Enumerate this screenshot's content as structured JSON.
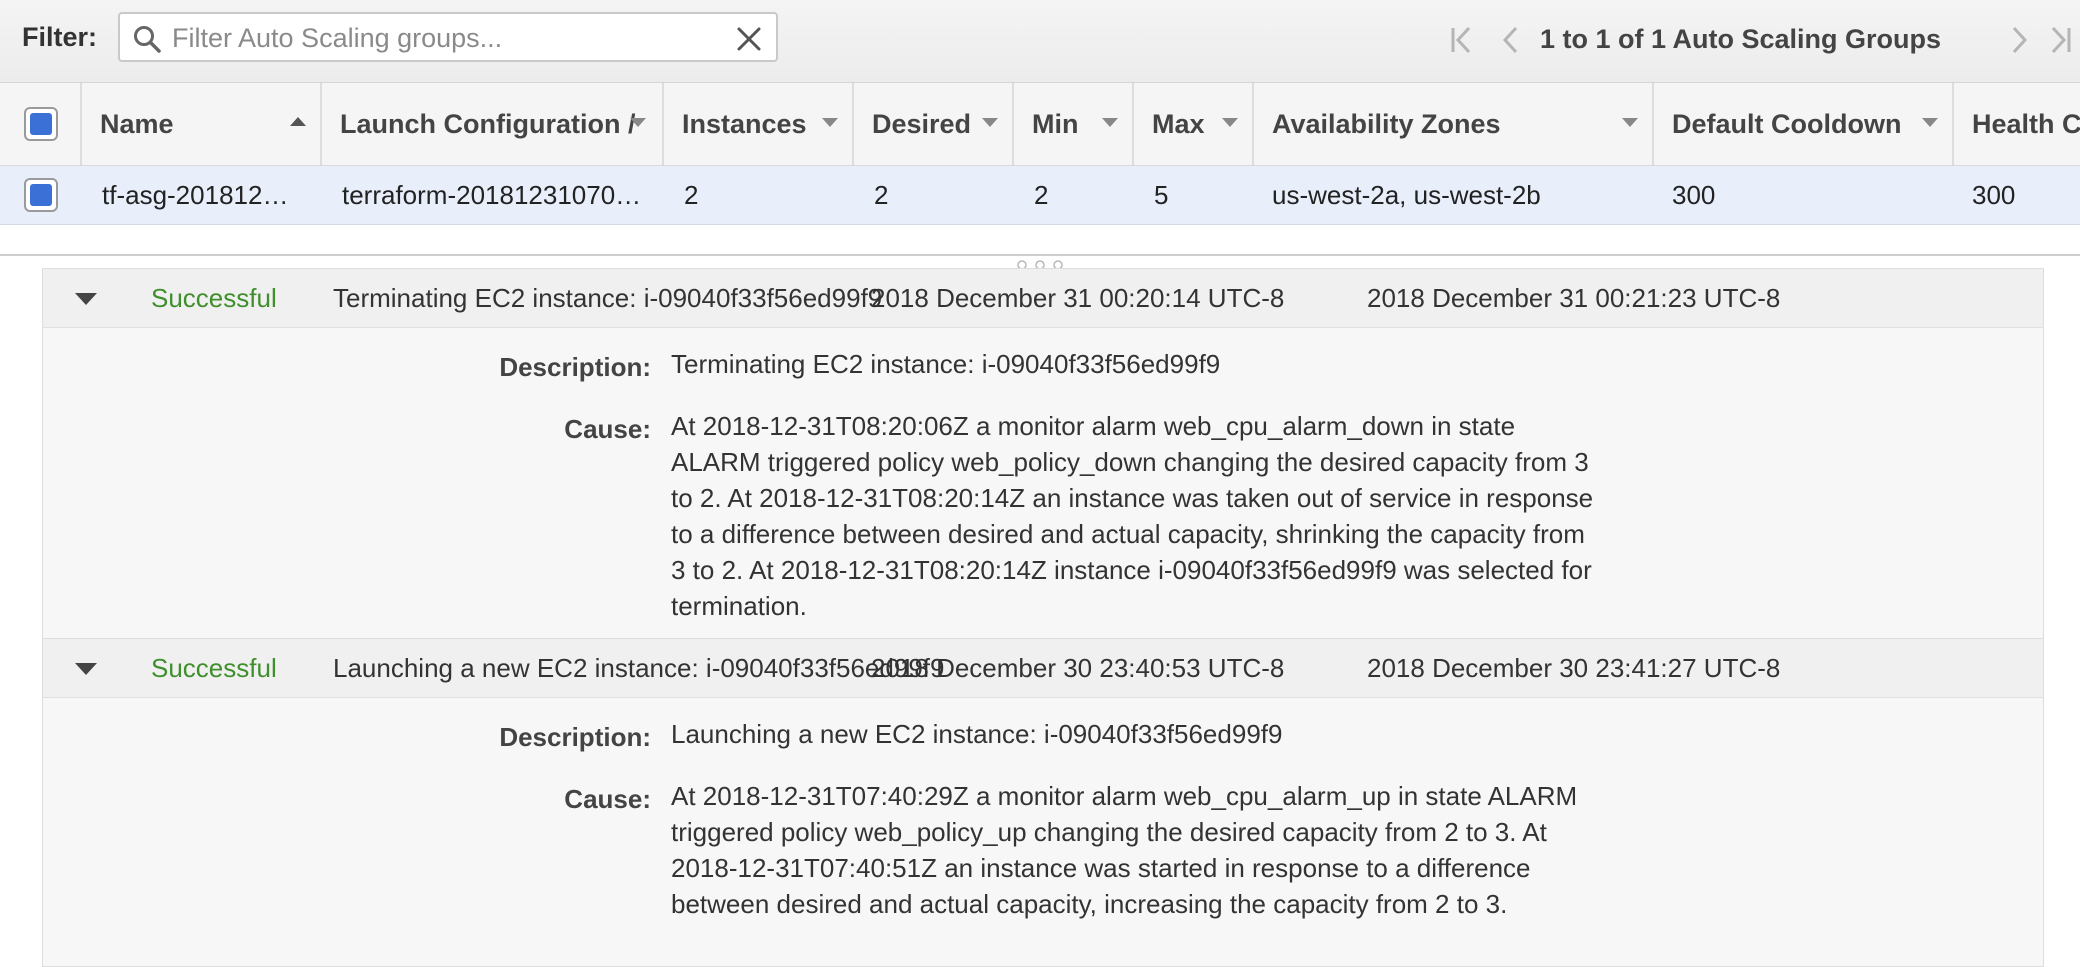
{
  "toolbar": {
    "filter_label": "Filter:",
    "search_placeholder": "Filter Auto Scaling groups...",
    "pagination_text": "1 to 1 of 1 Auto Scaling Groups"
  },
  "table": {
    "columns": [
      "Name",
      "Launch Configuration / ",
      "Instances",
      "Desired",
      "Min",
      "Max",
      "Availability Zones",
      "Default Cooldown",
      "Health C"
    ],
    "rows": [
      {
        "name": "tf-asg-201812…",
        "launch_configuration": "terraform-20181231070…",
        "instances": "2",
        "desired": "2",
        "min": "2",
        "max": "5",
        "availability_zones": "us-west-2a, us-west-2b",
        "default_cooldown": "300",
        "health_check": "300"
      }
    ]
  },
  "activities": [
    {
      "status": "Successful",
      "description": "Terminating EC2 instance: i-09040f33f56ed99f9",
      "start_time": "2018 December 31 00:20:14 UTC-8",
      "end_time": "2018 December 31 00:21:23 UTC-8",
      "description_label": "Description:",
      "description_value": "Terminating EC2 instance: i-09040f33f56ed99f9",
      "cause_label": "Cause:",
      "cause_value": "At 2018-12-31T08:20:06Z a monitor alarm web_cpu_alarm_down in state ALARM triggered policy web_policy_down changing the desired capacity from 3 to 2. At 2018-12-31T08:20:14Z an instance was taken out of service in response to a difference between desired and actual capacity, shrinking the capacity from 3 to 2. At 2018-12-31T08:20:14Z instance i-09040f33f56ed99f9 was selected for termination."
    },
    {
      "status": "Successful",
      "description": "Launching a new EC2 instance: i-09040f33f56ed99f9",
      "start_time": "2018 December 30 23:40:53 UTC-8",
      "end_time": "2018 December 30 23:41:27 UTC-8",
      "description_label": "Description:",
      "description_value": "Launching a new EC2 instance: i-09040f33f56ed99f9",
      "cause_label": "Cause:",
      "cause_value": "At 2018-12-31T07:40:29Z a monitor alarm web_cpu_alarm_up in state ALARM triggered policy web_policy_up changing the desired capacity from 2 to 3. At 2018-12-31T07:40:51Z an instance was started in response to a difference between desired and actual capacity, increasing the capacity from 2 to 3."
    }
  ],
  "colors": {
    "accent": "#3b71d6",
    "success": "#3f8f2d",
    "selected_row": "#e8effb"
  },
  "icons": {
    "search": "search-icon",
    "clear": "close-icon",
    "first_page": "first-page-icon",
    "prev_page": "prev-page-icon",
    "next_page": "next-page-icon",
    "last_page": "last-page-icon",
    "expand": "triangle-down-icon"
  }
}
